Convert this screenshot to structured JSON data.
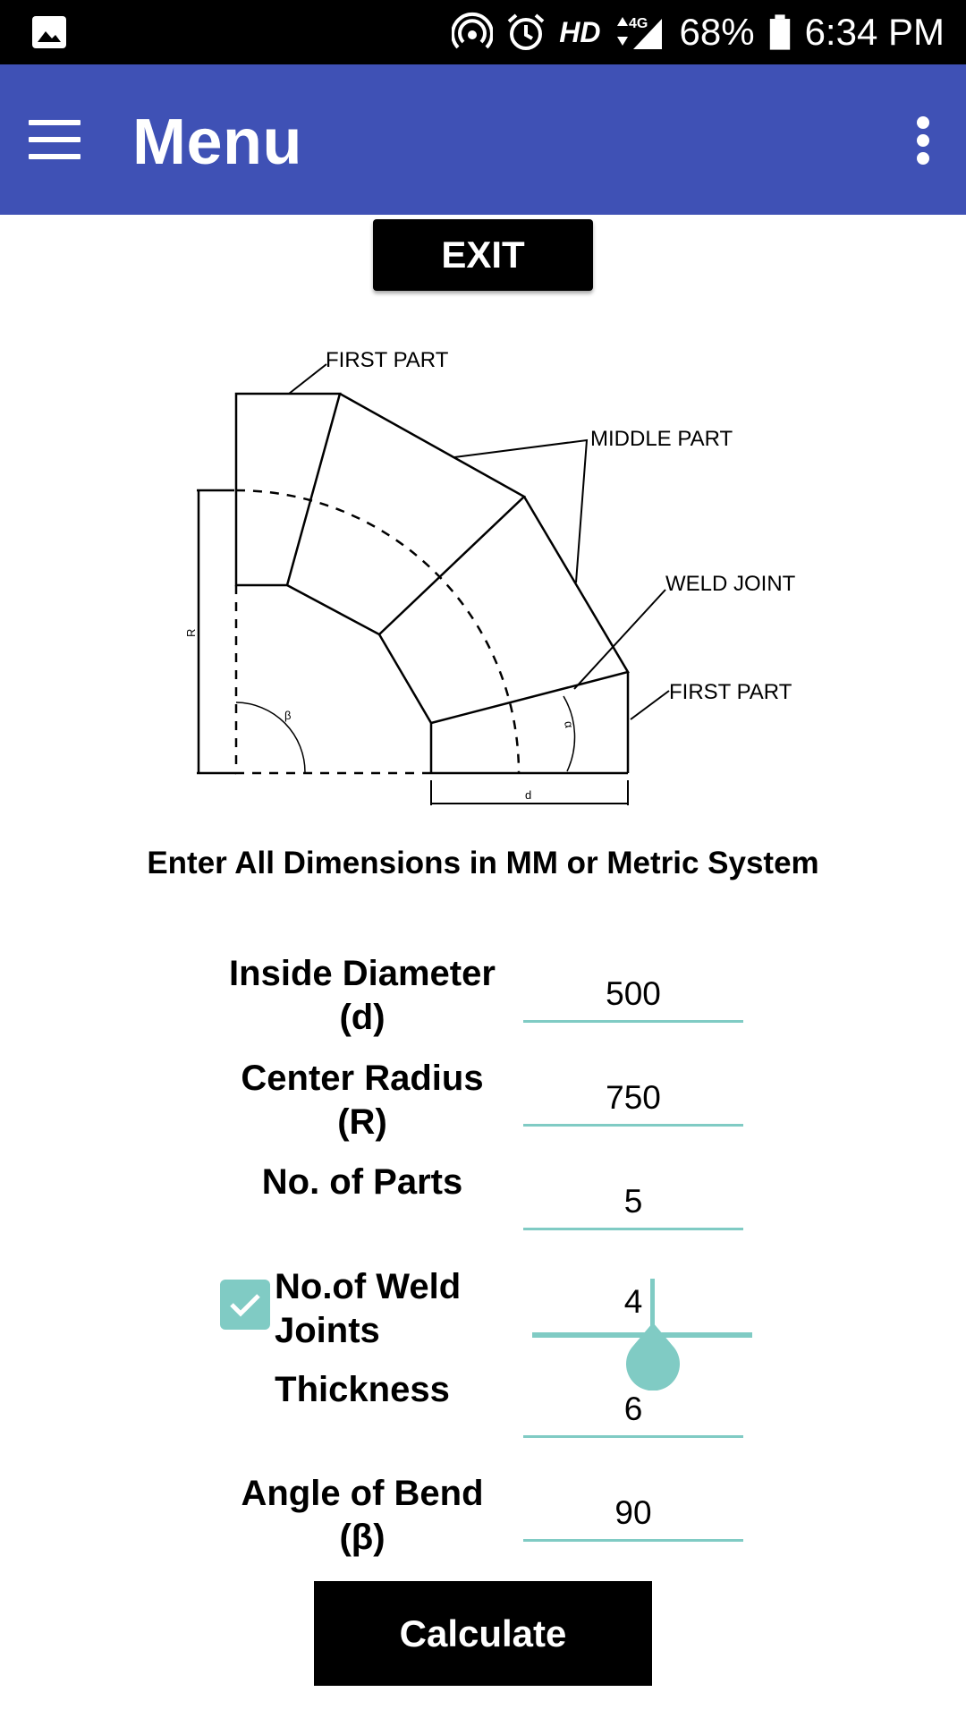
{
  "status_bar": {
    "icons": [
      "gallery-icon",
      "hotspot-icon",
      "alarm-icon",
      "signal-icon",
      "battery-icon"
    ],
    "network": "HD",
    "network_type": "4G",
    "battery": "68%",
    "time": "6:34 PM"
  },
  "app_bar": {
    "title": "Menu",
    "accent_color": "#3f51b5"
  },
  "exit_label": "EXIT",
  "diagram": {
    "labels": {
      "first_part_top": "FIRST PART",
      "middle_part": "MIDDLE PART",
      "weld_joint": "WELD JOINT",
      "first_part_bottom": "FIRST PART",
      "radius": "R",
      "beta": "β",
      "alpha": "α",
      "diameter": "d"
    }
  },
  "instructions": "Enter All Dimensions in MM or Metric System",
  "form": {
    "inside_diameter": {
      "label_line1": "Inside Diameter",
      "label_line2": "(d)",
      "value": "500"
    },
    "center_radius": {
      "label_line1": "Center Radius",
      "label_line2": "(R)",
      "value": "750"
    },
    "parts": {
      "label": "No. of Parts",
      "value": "5"
    },
    "weld_joints": {
      "label_line1": "No.of Weld",
      "label_line2": "Joints",
      "value": "4",
      "checked": true
    },
    "thickness": {
      "label": "Thickness",
      "value": "6"
    },
    "angle": {
      "label_line1": "Angle of Bend",
      "label_line2": "(β)",
      "value": "90"
    },
    "field_accent": "#80cbc4"
  },
  "calculate_label": "Calculate"
}
